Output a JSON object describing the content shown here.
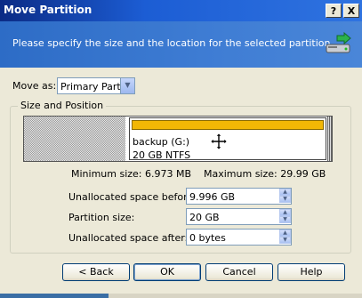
{
  "window": {
    "title": "Move Partition",
    "help_btn": "?",
    "close_btn": "X"
  },
  "header": {
    "text": "Please specify the size and the location for the selected partition."
  },
  "move_as": {
    "label": "Move as:",
    "value": "Primary Partition"
  },
  "size_position": {
    "group_title": "Size and Position",
    "partition_label": "backup (G:)",
    "partition_detail": "20 GB  NTFS",
    "minimum_size": "Minimum size: 6.973 MB",
    "maximum_size": "Maximum size: 29.99 GB"
  },
  "fields": {
    "before_label": "Unallocated space before:",
    "before_value": "9.996 GB",
    "size_label": "Partition size:",
    "size_value": "20 GB",
    "after_label": "Unallocated space after:",
    "after_value": "0 bytes"
  },
  "buttons": {
    "back": "< Back",
    "ok": "OK",
    "cancel": "Cancel",
    "help": "Help"
  },
  "colors": {
    "partition_bar": "#f2b705",
    "header_bg": "#3f7dd4"
  }
}
